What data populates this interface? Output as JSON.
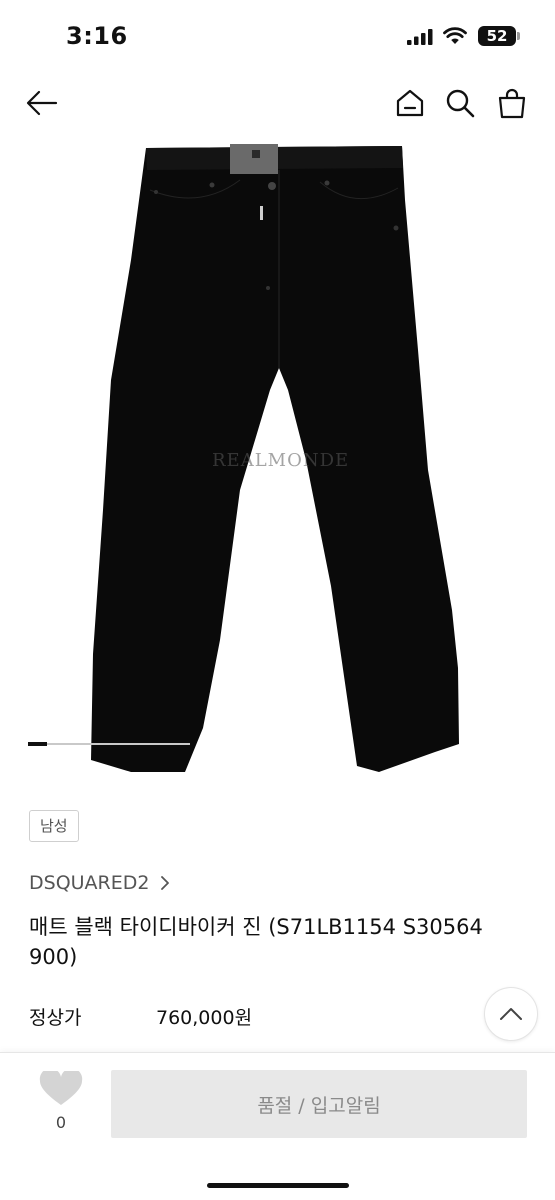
{
  "status_bar": {
    "time": "3:16",
    "battery": "52"
  },
  "nav": {
    "back_icon": "arrow-left-icon",
    "home_icon": "home-icon",
    "search_icon": "search-icon",
    "bag_icon": "shopping-bag-icon"
  },
  "gallery": {
    "watermark": "REALMONDE",
    "progress": 0.12
  },
  "product": {
    "gender_tag": "남성",
    "brand": "DSQUARED2",
    "title": "매트 블랙 타이디바이커 진 (S71LB1154 S30564 900)",
    "price_label": "정상가",
    "price": "760,000원"
  },
  "bottom_bar": {
    "like_count": "0",
    "soldout_label": "품절 / 입고알림"
  },
  "colors": {
    "accent": "#111111",
    "button_bg": "#e8e8e8",
    "button_text": "#8a8a8a"
  }
}
